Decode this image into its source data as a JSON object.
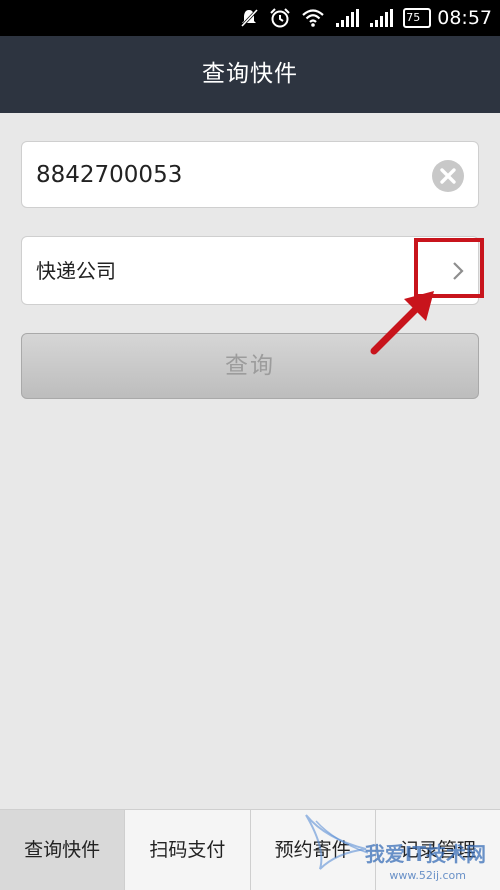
{
  "status_bar": {
    "battery": "75",
    "time": "08:57",
    "icons": [
      "mute-icon",
      "alarm-icon",
      "wifi-icon",
      "signal-icon",
      "signal-icon",
      "battery-icon"
    ]
  },
  "header": {
    "title": "查询快件"
  },
  "form": {
    "tracking_number": "8842700053",
    "company_label": "快递公司",
    "query_button": "查询"
  },
  "tabs": [
    {
      "label": "查询快件",
      "selected": true
    },
    {
      "label": "扫码支付",
      "selected": false
    },
    {
      "label": "预约寄件",
      "selected": false
    },
    {
      "label": "记录管理",
      "selected": false
    }
  ],
  "watermark": {
    "text": "我爱IT技术网",
    "url": "www.52ij.com"
  },
  "colors": {
    "title_bar": "#2d3440",
    "annotation": "#c8141c",
    "background": "#e8e8e8"
  }
}
